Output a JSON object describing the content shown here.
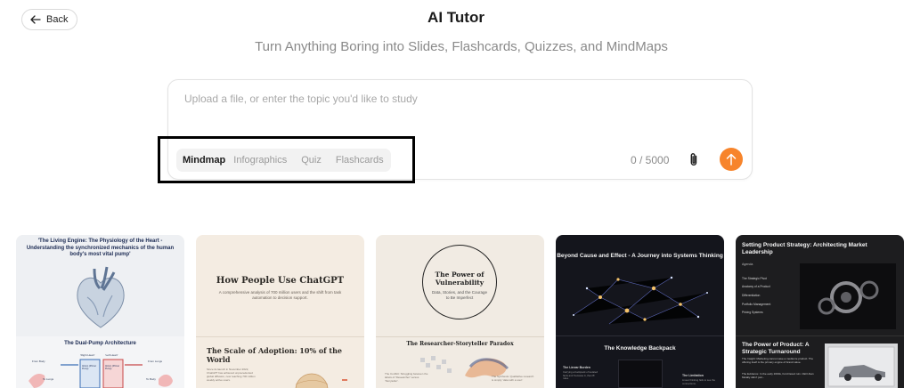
{
  "header": {
    "back_label": "Back",
    "title": "AI Tutor",
    "subtitle": "Turn Anything Boring into Slides, Flashcards, Quizzes, and MindMaps"
  },
  "composer": {
    "placeholder": "Upload a file, or enter the topic you'd like to study",
    "value": "",
    "modes": [
      "Mindmap",
      "Infographics",
      "Quiz",
      "Flashcards"
    ],
    "selected_mode": "Mindmap",
    "char_count": "0 / 5000"
  },
  "colors": {
    "accent": "#f7842b",
    "highlight_border": "#000000"
  },
  "icons": {
    "back": "arrow-left-icon",
    "attach": "paperclip-icon",
    "send": "arrow-up-icon"
  },
  "cards": [
    {
      "title": "'The Living Engine: The Physiology of the Heart - Understanding the synchronized mechanics of the human body's most vital pump'",
      "section": "The Dual-Pump Architecture",
      "labels": [
        "From Body",
        "'Right Heart'",
        "'Left Heart'",
        "From Lungs",
        "Atrium (Primer Pump)",
        "Atrium (Primer Pump)",
        "To Lungs",
        "To Body"
      ]
    },
    {
      "title": "How People Use ChatGPT",
      "subtitle": "A comprehensive analysis of 700 million users and the shift from task automation to decision support.",
      "section": "The Scale of Adoption: 10% of the World",
      "note": "Since its launch in November 2022, ChatGPT has achieved unprecedented global diffusion, now reaching 700 million weekly active users."
    },
    {
      "title": "The Power of Vulnerability",
      "subtitle": "Data, Stories, and the Courage to Be Imperfect",
      "section": "The Researcher-Storyteller Paradox",
      "note_left": "The Conflict: Struggling between the labels of 'Researcher' versus 'Storyteller'.",
      "note_right": "The Synthesis: Qualitative research is simply 'data with a soul.'"
    },
    {
      "title": "Beyond Cause and Effect - A Journey into Systems Thinking",
      "section": "The Knowledge Backpack",
      "label_left": "The Linear Burden",
      "note_left": "Carrying a backpack of isolated facts and 'because A, then B' rules.",
      "label_right": "The Limitation",
      "note_right": "Linear thinking fails to see the connections."
    },
    {
      "title": "Setting Product Strategy: Architecting Market Leadership",
      "agenda_title": "Agenda",
      "agenda": [
        "The Strategic Pivot",
        "Anatomy of a Product",
        "Differentiation",
        "Portfolio Management",
        "Pricing Systems"
      ],
      "section": "The Power of Product: A Strategic Turnaround",
      "bullets": [
        "The Insight: Marketing cannot save a mediocre product. The offering itself is the primary engine of brand value.",
        "The Evidence: In the early 2000s, Ford faced ruin. CEO Alan Mulally didn't just..."
      ]
    }
  ]
}
